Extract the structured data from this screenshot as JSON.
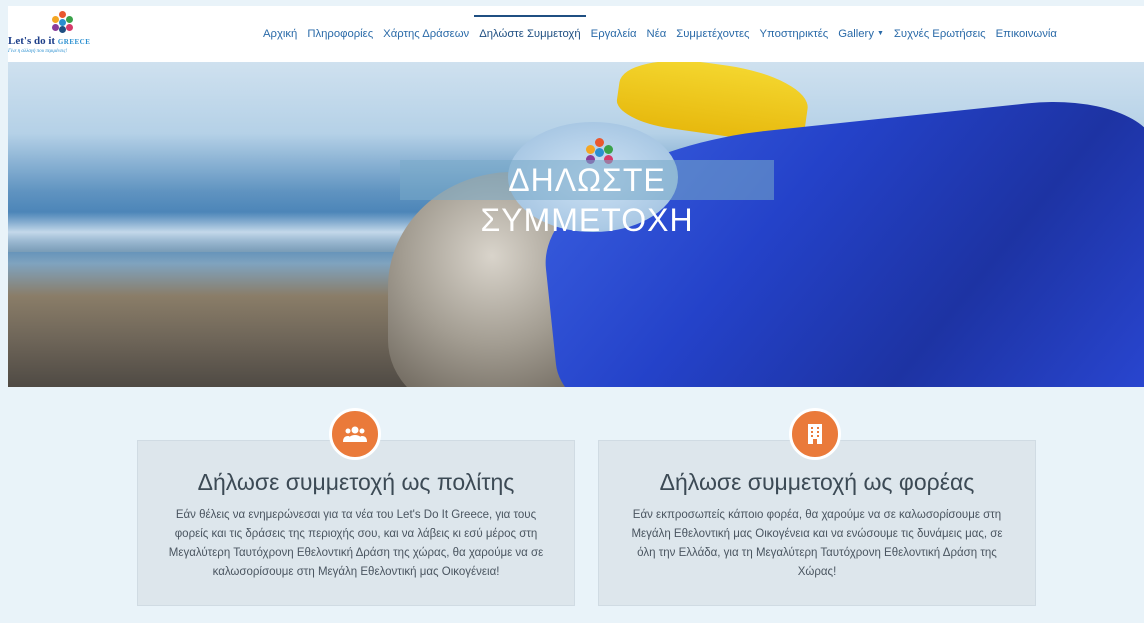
{
  "brand": {
    "logo_name": "Let's do it",
    "logo_region": "GREECE",
    "tagline": "Γίνε η αλλαγή που περιμένεις!",
    "dot_colors": [
      "#e9582f",
      "#f4a623",
      "#3aa24a",
      "#2a8fd0",
      "#8a3c9a",
      "#d63a6a",
      "#1f4f82"
    ]
  },
  "nav": {
    "items": [
      {
        "label": "Αρχική"
      },
      {
        "label": "Πληροφορίες"
      },
      {
        "label": "Χάρτης Δράσεων"
      },
      {
        "label": "Δηλώστε Συμμετοχή",
        "active": true
      },
      {
        "label": "Εργαλεία"
      },
      {
        "label": "Νέα"
      },
      {
        "label": "Συμμετέχοντες"
      },
      {
        "label": "Υποστηρικτές"
      },
      {
        "label": "Gallery",
        "dropdown": true
      },
      {
        "label": "Συχνές Ερωτήσεις"
      },
      {
        "label": "Επικοινωνία"
      }
    ]
  },
  "hero": {
    "title": "ΔΗΛΩΣΤΕ ΣΥΜΜΕΤΟΧΗ"
  },
  "cards": [
    {
      "icon": "group-icon",
      "title": "Δήλωσε συμμετοχή ως πολίτης",
      "text": "Εάν θέλεις να ενημερώνεσαι για τα νέα του Let's Do It Greece, για τους φορείς και τις δράσεις της περιοχής σου, και να λάβεις κι εσύ μέρος στη Μεγαλύτερη Ταυτόχρονη Εθελοντική Δράση της χώρας, θα χαρούμε να σε καλωσορίσουμε στη Μεγάλη Εθελοντική μας Οικογένεια!"
    },
    {
      "icon": "building-icon",
      "title": "Δήλωσε συμμετοχή ως φορέας",
      "text": "Εάν εκπροσωπείς κάποιο φορέα, θα χαρούμε να σε καλωσορίσουμε στη Μεγάλη Εθελοντική μας Οικογένεια και να ενώσουμε τις δυνάμεις μας, σε όλη την Ελλάδα, για τη Μεγαλύτερη Ταυτόχρονη Εθελοντική Δράση της Χώρας!"
    }
  ],
  "colors": {
    "accent": "#ea7a3a",
    "nav_link": "#2a6aa8",
    "background": "#e9f3f9"
  }
}
